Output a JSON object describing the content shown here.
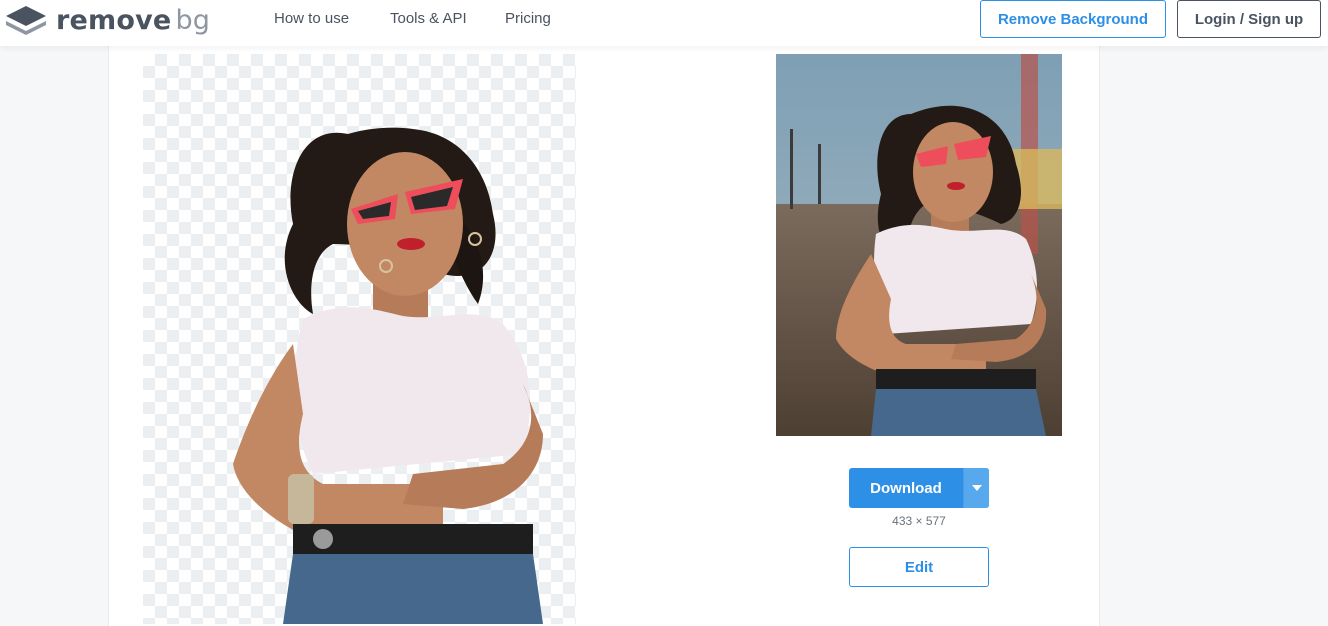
{
  "header": {
    "logo_text": "remove",
    "logo_text_accent": "bg",
    "nav": [
      "How to use",
      "Tools & API",
      "Pricing"
    ],
    "cta_remove": "Remove Background",
    "cta_login": "Login / Sign up"
  },
  "result": {
    "download_label": "Download",
    "dimensions": "433 × 577",
    "edit_label": "Edit"
  },
  "colors": {
    "accent": "#2d8fe6",
    "text": "#4a5360"
  },
  "icons": {
    "logo": "layers-icon",
    "dropdown": "caret-down-icon"
  }
}
